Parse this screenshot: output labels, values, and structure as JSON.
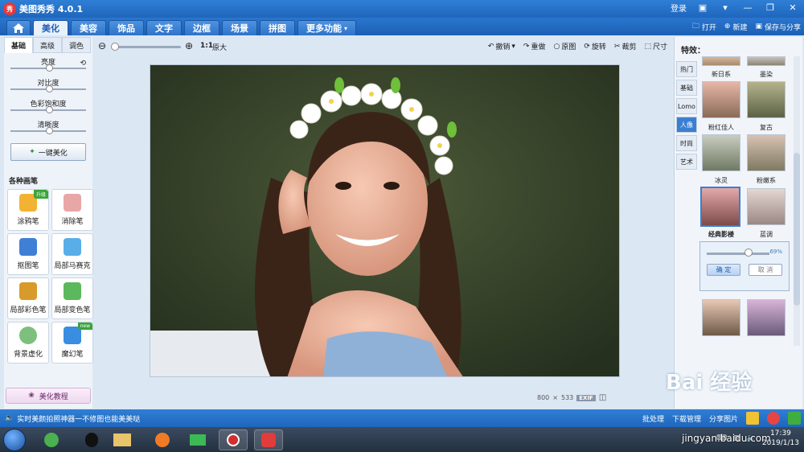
{
  "window": {
    "title": "美图秀秀 4.0.1",
    "login": "登录",
    "controls": [
      "消息",
      "菜单",
      "最小化",
      "还原",
      "关闭"
    ]
  },
  "tabs": {
    "items": [
      {
        "label": "",
        "icon": "home-icon",
        "active": false
      },
      {
        "label": "美化",
        "active": true
      },
      {
        "label": "美容",
        "active": false
      },
      {
        "label": "饰品",
        "active": false
      },
      {
        "label": "文字",
        "active": false
      },
      {
        "label": "边框",
        "active": false
      },
      {
        "label": "场景",
        "active": false
      },
      {
        "label": "拼图",
        "active": false
      },
      {
        "label": "更多功能",
        "active": false
      }
    ],
    "actions": {
      "open": "打开",
      "new": "新建",
      "save": "保存与分享"
    }
  },
  "toolbar": {
    "zoom_ratio": "1:1",
    "original_size": "原大",
    "undo": "撤销",
    "redo": "重做",
    "original": "原图",
    "rotate": "旋转",
    "crop": "裁剪",
    "size": "尺寸"
  },
  "left_panel": {
    "subtabs": [
      {
        "label": "基础",
        "active": true
      },
      {
        "label": "高级",
        "active": false
      },
      {
        "label": "调色",
        "active": false
      }
    ],
    "adjustments": [
      {
        "label": "亮度",
        "value": 0.5
      },
      {
        "label": "对比度",
        "value": 0.5
      },
      {
        "label": "色彩饱和度",
        "value": 0.5
      },
      {
        "label": "清晰度",
        "value": 0.5
      }
    ],
    "one_click": "一键美化",
    "brushes_title": "各种画笔",
    "brushes": [
      {
        "label": "涂鸦笔",
        "badge": "升级",
        "color": "#f2b233"
      },
      {
        "label": "消除笔",
        "badge": "",
        "color": "#e9a6a6"
      },
      {
        "label": "抠图笔",
        "badge": "",
        "color": "#3f7fd6"
      },
      {
        "label": "局部马赛克",
        "badge": "",
        "color": "#5aaee8"
      },
      {
        "label": "局部彩色笔",
        "badge": "",
        "color": "#d89a2a"
      },
      {
        "label": "局部变色笔",
        "badge": "",
        "color": "#5cb85c"
      },
      {
        "label": "背景虚化",
        "badge": "",
        "color": "#7dbf7d"
      },
      {
        "label": "魔幻笔",
        "badge": "new",
        "color": "#3a8ee0"
      }
    ],
    "tutorial": "美化教程"
  },
  "image_info": {
    "width": "800",
    "x": "×",
    "height": "533",
    "exif": "EXIF"
  },
  "right_panel": {
    "title": "特效：",
    "categories": [
      {
        "label": "热门",
        "active": false
      },
      {
        "label": "基础",
        "active": false
      },
      {
        "label": "Lomo",
        "active": false
      },
      {
        "label": "人像",
        "active": true
      },
      {
        "label": "时尚",
        "active": false
      },
      {
        "label": "艺术",
        "active": false
      }
    ],
    "effects": [
      {
        "label": "新日系",
        "selected": false
      },
      {
        "label": "墨染",
        "selected": false
      },
      {
        "label": "粉红佳人",
        "selected": false
      },
      {
        "label": "复古",
        "selected": false
      },
      {
        "label": "冰灵",
        "selected": false
      },
      {
        "label": "粉嫩系",
        "selected": false
      },
      {
        "label": "经典影楼",
        "selected": true
      },
      {
        "label": "蓝调",
        "selected": false
      }
    ],
    "popup": {
      "percent": "69%",
      "value": 0.69,
      "confirm": "确 定",
      "cancel": "取 消"
    }
  },
  "statusbar": {
    "message": "实时美颜拍照神器一不修图也能美美哒",
    "batch": "批处理",
    "download": "下载管理",
    "share": "分享图片"
  },
  "taskbar": {
    "time": "17:39",
    "date": "2019/1/13"
  },
  "watermark": {
    "brand": "Bai 经验",
    "site": "jingyan.baidu.com"
  }
}
